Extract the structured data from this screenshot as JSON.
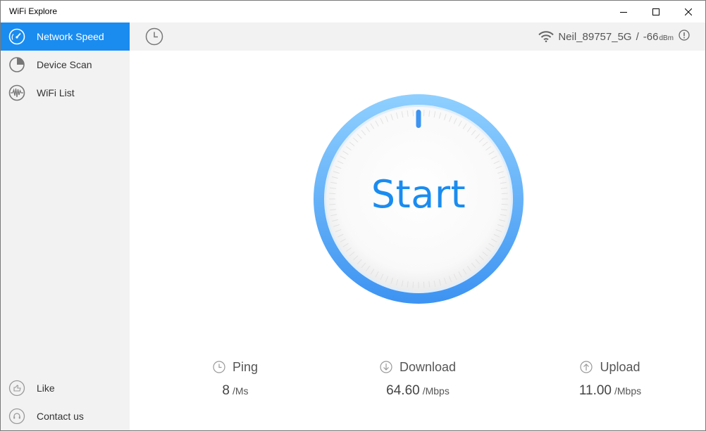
{
  "window": {
    "title": "WiFi Explore"
  },
  "sidebar": {
    "items": [
      {
        "label": "Network Speed",
        "icon": "speedometer-icon",
        "active": true
      },
      {
        "label": "Device Scan",
        "icon": "pie-scan-icon",
        "active": false
      },
      {
        "label": "WiFi List",
        "icon": "signal-wave-icon",
        "active": false
      }
    ],
    "bottom": [
      {
        "label": "Like",
        "icon": "thumbs-up-icon"
      },
      {
        "label": "Contact us",
        "icon": "headset-icon"
      }
    ]
  },
  "header": {
    "network_name": "Neil_89757_5G",
    "separator": "/",
    "signal_value": "-66",
    "signal_unit": "dBm"
  },
  "gauge": {
    "label": "Start"
  },
  "stats": [
    {
      "name": "ping",
      "label": "Ping",
      "value": "8",
      "unit": "/Ms",
      "icon": "clock-icon"
    },
    {
      "name": "download",
      "label": "Download",
      "value": "64.60",
      "unit": "/Mbps",
      "icon": "arrow-down-circle-icon"
    },
    {
      "name": "upload",
      "label": "Upload",
      "value": "11.00",
      "unit": "/Mbps",
      "icon": "arrow-up-circle-icon"
    }
  ],
  "colors": {
    "accent": "#1a8cf0",
    "sidebar_bg": "#f2f2f2",
    "ring_light": "#8fd0ff",
    "ring_dark": "#3d93f2"
  }
}
